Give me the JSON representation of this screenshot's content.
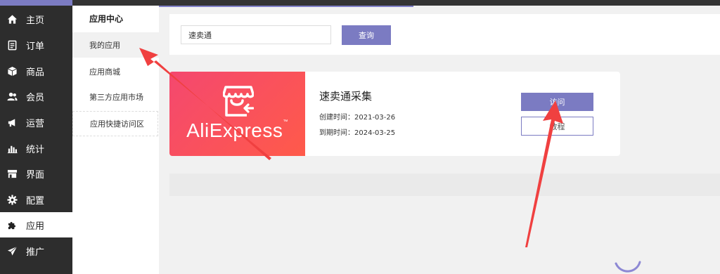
{
  "nav": {
    "items": [
      {
        "label": "主页",
        "icon": "home-icon"
      },
      {
        "label": "订单",
        "icon": "order-icon"
      },
      {
        "label": "商品",
        "icon": "product-icon"
      },
      {
        "label": "会员",
        "icon": "member-icon"
      },
      {
        "label": "运营",
        "icon": "megaphone-icon"
      },
      {
        "label": "统计",
        "icon": "chart-icon"
      },
      {
        "label": "界面",
        "icon": "storefront-icon"
      },
      {
        "label": "配置",
        "icon": "gear-icon"
      },
      {
        "label": "应用",
        "icon": "puzzle-icon"
      },
      {
        "label": "推广",
        "icon": "send-icon"
      }
    ],
    "active": "应用"
  },
  "submenu": {
    "title": "应用中心",
    "items": [
      "我的应用",
      "应用商城",
      "第三方应用市场",
      "应用快捷访问区"
    ]
  },
  "search": {
    "value": "速卖通",
    "button_label": "查询"
  },
  "app": {
    "logo_text": "AliExpress",
    "logo_mark": "™",
    "name": "速卖通采集",
    "created": "创建时间：2021-03-26",
    "expires": "到期时间：2024-03-25",
    "visit_label": "访问",
    "tutorial_label": "教程"
  },
  "colors": {
    "accent": "#7b7bc2",
    "sidebar_bg": "#2d2d2d",
    "logo_bg": "#f4486f",
    "arrow": "#f04040"
  }
}
